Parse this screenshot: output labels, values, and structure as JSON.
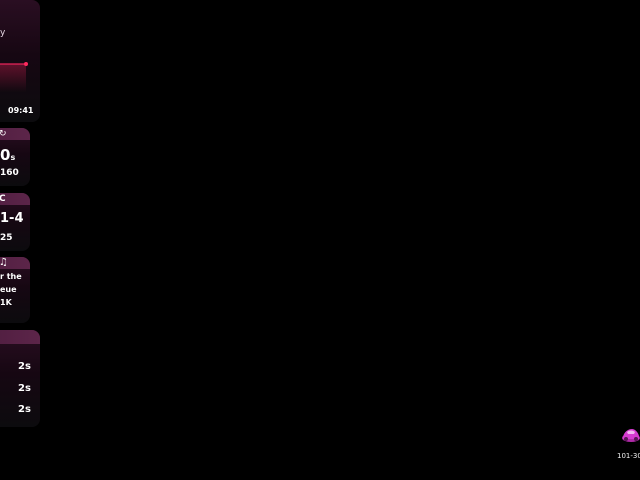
{
  "top_panel": {
    "title_fragment": "y",
    "time": "09:41",
    "line_color": "#e8245a"
  },
  "cards": [
    {
      "icon": "stopwatch-icon",
      "value_main": "0",
      "value_unit": "s",
      "value_sub": "160"
    },
    {
      "icon": "trophy-icon",
      "value_main": "1-4",
      "value_sub": "25"
    },
    {
      "icon": "music-icon",
      "line1": "r the",
      "line2": "eue",
      "line3": "1K"
    }
  ],
  "list_panel": {
    "rows": [
      {
        "value": "2s"
      },
      {
        "value": "2s"
      },
      {
        "value": "2s"
      }
    ]
  },
  "track": {
    "id": "101-30"
  },
  "colors": {
    "accent": "#e8245a",
    "car": "#d63ad0"
  }
}
